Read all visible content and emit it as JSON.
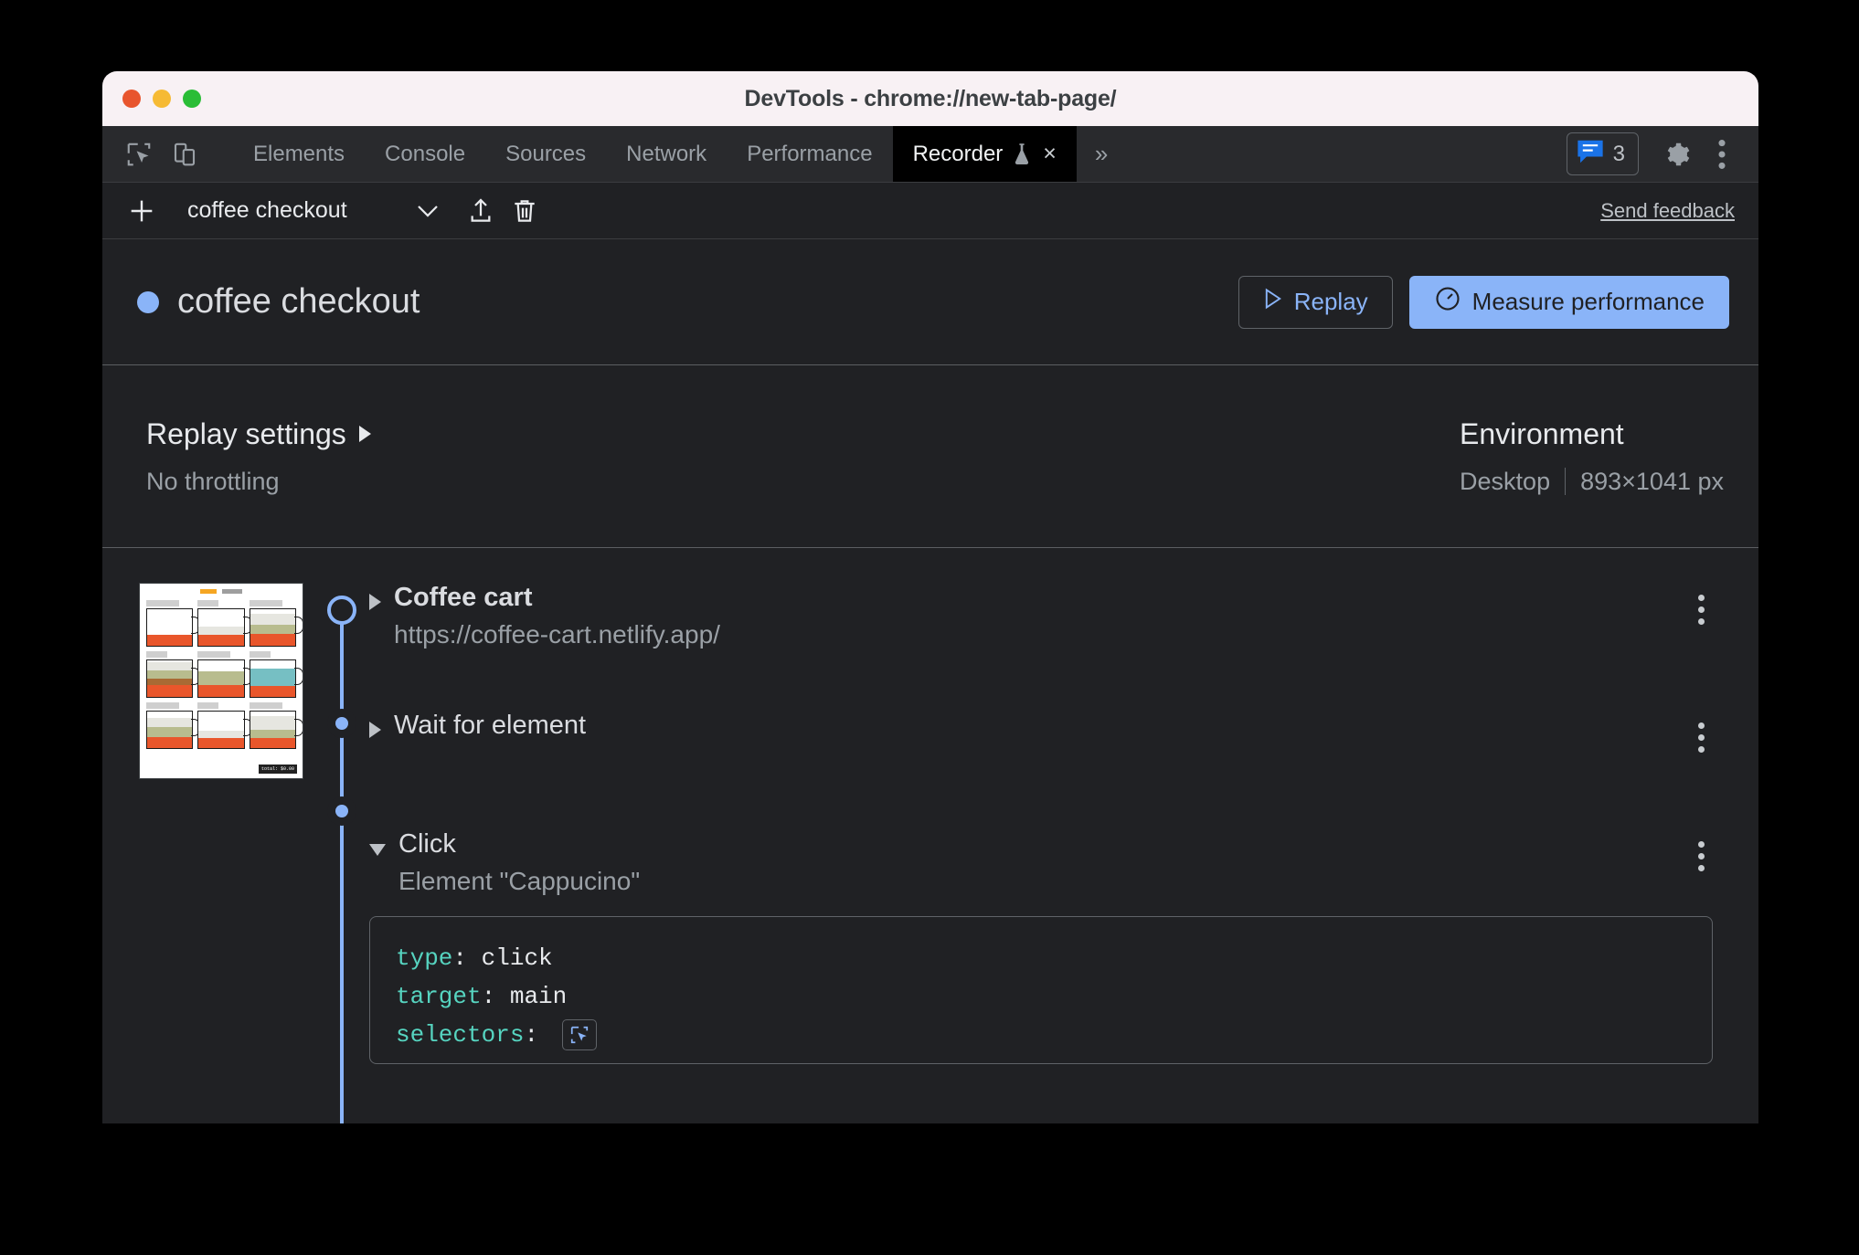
{
  "window": {
    "title": "DevTools - chrome://new-tab-page/",
    "traffic_lights": [
      "close-button",
      "minimize-button",
      "maximize-button"
    ]
  },
  "devtools_tabbar": {
    "left_icons": [
      {
        "name": "inspect-element-icon",
        "label": "Inspect element"
      },
      {
        "name": "device-toolbar-icon",
        "label": "Toggle device toolbar"
      }
    ],
    "tabs": [
      {
        "label": "Elements",
        "active": false
      },
      {
        "label": "Console",
        "active": false
      },
      {
        "label": "Sources",
        "active": false
      },
      {
        "label": "Network",
        "active": false
      },
      {
        "label": "Performance",
        "active": false
      },
      {
        "label": "Recorder",
        "active": true,
        "experimental": true,
        "closable": true
      }
    ],
    "overflow_label": "»",
    "close_glyph": "×",
    "messages_count": "3",
    "right_icons": [
      {
        "name": "settings-gear-icon",
        "label": "Settings"
      },
      {
        "name": "more-options-icon",
        "label": "Customize and control DevTools"
      }
    ]
  },
  "recorder_toolbar": {
    "add_label": "+",
    "recording_name": "coffee checkout",
    "actions": [
      {
        "name": "export-recording-button",
        "label": "Export recording"
      },
      {
        "name": "delete-recording-button",
        "label": "Delete recording"
      }
    ],
    "send_feedback": "Send feedback"
  },
  "recording_header": {
    "title": "coffee checkout",
    "status_color": "#8AB4F8",
    "replay_label": "Replay",
    "measure_label": "Measure performance"
  },
  "settings": {
    "replay_settings_title": "Replay settings",
    "throttling_value": "No throttling",
    "environment_title": "Environment",
    "environment_device": "Desktop",
    "environment_viewport": "893×1041 px"
  },
  "steps": [
    {
      "title": "Coffee cart",
      "subtitle": "https://coffee-cart.netlify.app/",
      "expanded": false,
      "bold": true,
      "marker": "hollow"
    },
    {
      "title": "Wait for element",
      "subtitle": "",
      "expanded": false,
      "bold": false,
      "marker": "filled"
    },
    {
      "title": "Click",
      "subtitle": "Element \"Cappucino\"",
      "expanded": true,
      "bold": false,
      "marker": "filled",
      "code": [
        {
          "key": "type",
          "value": "click"
        },
        {
          "key": "target",
          "value": "main"
        },
        {
          "key": "selectors",
          "value": "",
          "picker": true
        }
      ]
    }
  ],
  "colors": {
    "accent_blue": "#8AB4F8",
    "panel_bg": "#202124",
    "tabstrip_bg": "#292A2D",
    "active_tab_bg": "#000000",
    "titlebar_bg": "#F8F1F4",
    "code_key": "#56D4C0",
    "text_primary": "#E8EAED",
    "text_secondary": "#9AA0A6"
  },
  "thumbnail": {
    "name": "coffee-cart-page-screenshot",
    "badge": "total: $0.00"
  }
}
